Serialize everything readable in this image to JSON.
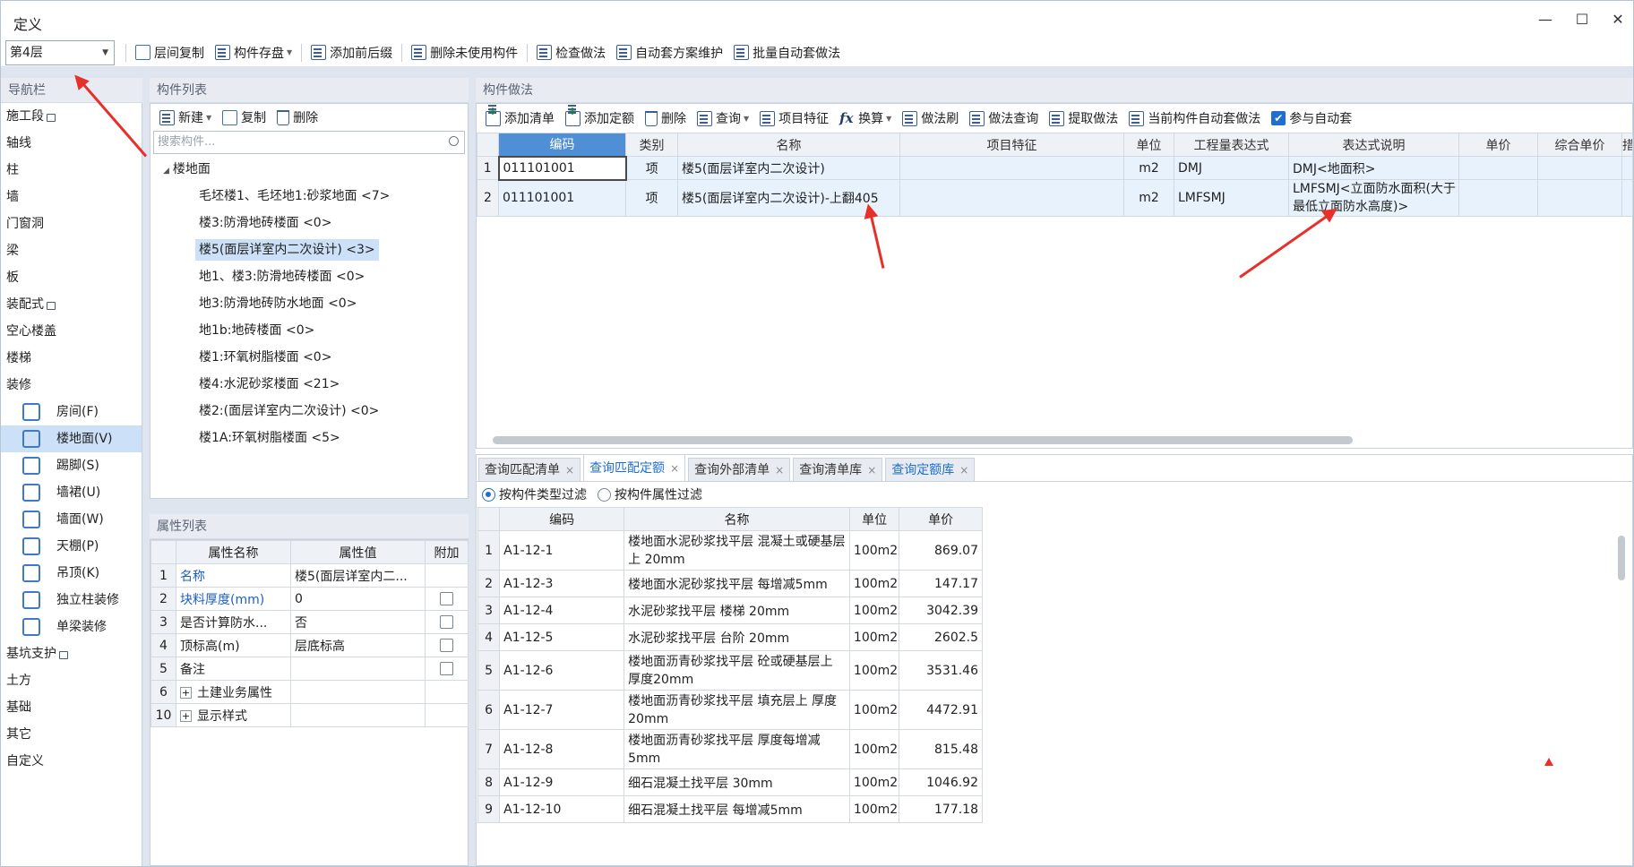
{
  "window": {
    "title": "定义"
  },
  "toolbar": {
    "floor": "第4层",
    "buttons": [
      "层间复制",
      "构件存盘",
      "添加前后缀",
      "删除未使用构件",
      "检查做法",
      "自动套方案维护",
      "批量自动套做法"
    ]
  },
  "nav": {
    "title": "导航栏",
    "items": [
      {
        "label": "施工段",
        "lock": true
      },
      {
        "label": "轴线"
      },
      {
        "label": "柱"
      },
      {
        "label": "墙"
      },
      {
        "label": "门窗洞"
      },
      {
        "label": "梁"
      },
      {
        "label": "板"
      },
      {
        "label": "装配式",
        "lock": true
      },
      {
        "label": "空心楼盖"
      },
      {
        "label": "楼梯"
      },
      {
        "label": "装修"
      }
    ],
    "sub_items": [
      "房间(F)",
      "楼地面(V)",
      "踢脚(S)",
      "墙裙(U)",
      "墙面(W)",
      "天棚(P)",
      "吊顶(K)",
      "独立柱装修",
      "单梁装修"
    ],
    "bottom_items": [
      {
        "label": "基坑支护",
        "lock": true
      },
      {
        "label": "土方"
      },
      {
        "label": "基础"
      },
      {
        "label": "其它"
      },
      {
        "label": "自定义"
      }
    ]
  },
  "component_list": {
    "title": "构件列表",
    "new": "新建",
    "copy": "复制",
    "delete": "删除",
    "search_placeholder": "搜索构件...",
    "root": "楼地面",
    "items": [
      "毛坯楼1、毛坯地1:砂浆地面 <7>",
      "楼3:防滑地砖楼面 <0>",
      "楼5(面层详室内二次设计) <3>",
      "地1、楼3:防滑地砖楼面 <0>",
      "地3:防滑地砖防水地面 <0>",
      "地1b:地砖楼面 <0>",
      "楼1:环氧树脂楼面 <0>",
      "楼4:水泥砂浆楼面 <21>",
      "楼2:(面层详室内二次设计) <0>",
      "楼1A:环氧树脂楼面 <5>"
    ]
  },
  "props": {
    "title": "属性列表",
    "headers": [
      "属性名称",
      "属性值",
      "附加"
    ],
    "rows": [
      {
        "n": "1",
        "name": "名称",
        "value": "楼5(面层详室内二..."
      },
      {
        "n": "2",
        "name": "块料厚度(mm)",
        "value": "0"
      },
      {
        "n": "3",
        "name": "是否计算防水...",
        "value": "否"
      },
      {
        "n": "4",
        "name": "顶标高(m)",
        "value": "层底标高"
      },
      {
        "n": "5",
        "name": "备注",
        "value": ""
      },
      {
        "n": "6",
        "name": "土建业务属性",
        "value": ""
      },
      {
        "n": "10",
        "name": "显示样式",
        "value": ""
      }
    ]
  },
  "method": {
    "title": "构件做法",
    "buttons": [
      "添加清单",
      "添加定额",
      "删除",
      "查询",
      "项目特征",
      "换算",
      "做法刷",
      "做法查询",
      "提取做法",
      "当前构件自动套做法",
      "参与自动套"
    ],
    "headers": [
      "编码",
      "类别",
      "名称",
      "项目特征",
      "单位",
      "工程量表达式",
      "表达式说明",
      "单价",
      "综合单价",
      "措"
    ],
    "rows": [
      {
        "n": "1",
        "code": "011101001",
        "type": "项",
        "name": "楼5(面层详室内二次设计)",
        "feature": "",
        "unit": "m2",
        "expr": "DMJ",
        "desc": "DMJ<地面积>"
      },
      {
        "n": "2",
        "code": "011101001",
        "type": "项",
        "name": "楼5(面层详室内二次设计)-上翻405",
        "feature": "",
        "unit": "m2",
        "expr": "LMFSMJ",
        "desc": "LMFSMJ<立面防水面积(大于最低立面防水高度)>"
      }
    ]
  },
  "query": {
    "tabs": [
      "查询匹配清单",
      "查询匹配定额",
      "查询外部清单",
      "查询清单库",
      "查询定额库"
    ],
    "filter_type": "按构件类型过滤",
    "filter_attr": "按构件属性过滤",
    "headers": [
      "编码",
      "名称",
      "单位",
      "单价"
    ],
    "rows": [
      {
        "n": "1",
        "code": "A1-12-1",
        "name": "楼地面水泥砂浆找平层 混凝土或硬基层上 20mm",
        "unit": "100m2",
        "price": "869.07"
      },
      {
        "n": "2",
        "code": "A1-12-3",
        "name": "楼地面水泥砂浆找平层 每增减5mm",
        "unit": "100m2",
        "price": "147.17"
      },
      {
        "n": "3",
        "code": "A1-12-4",
        "name": "水泥砂浆找平层 楼梯 20mm",
        "unit": "100m2",
        "price": "3042.39"
      },
      {
        "n": "4",
        "code": "A1-12-5",
        "name": "水泥砂浆找平层 台阶 20mm",
        "unit": "100m2",
        "price": "2602.5"
      },
      {
        "n": "5",
        "code": "A1-12-6",
        "name": "楼地面沥青砂浆找平层 砼或硬基层上 厚度20mm",
        "unit": "100m2",
        "price": "3531.46"
      },
      {
        "n": "6",
        "code": "A1-12-7",
        "name": "楼地面沥青砂浆找平层 填充层上 厚度20mm",
        "unit": "100m2",
        "price": "4472.91"
      },
      {
        "n": "7",
        "code": "A1-12-8",
        "name": "楼地面沥青砂浆找平层 厚度每增减5mm",
        "unit": "100m2",
        "price": "815.48"
      },
      {
        "n": "8",
        "code": "A1-12-9",
        "name": "细石混凝土找平层 30mm",
        "unit": "100m2",
        "price": "1046.92"
      },
      {
        "n": "9",
        "code": "A1-12-10",
        "name": "细石混凝土找平层 每增减5mm",
        "unit": "100m2",
        "price": "177.18"
      }
    ]
  },
  "colors": {
    "accent": "#1f6fd1",
    "selection": "#cce0f7",
    "annotation": "#e8302a"
  }
}
